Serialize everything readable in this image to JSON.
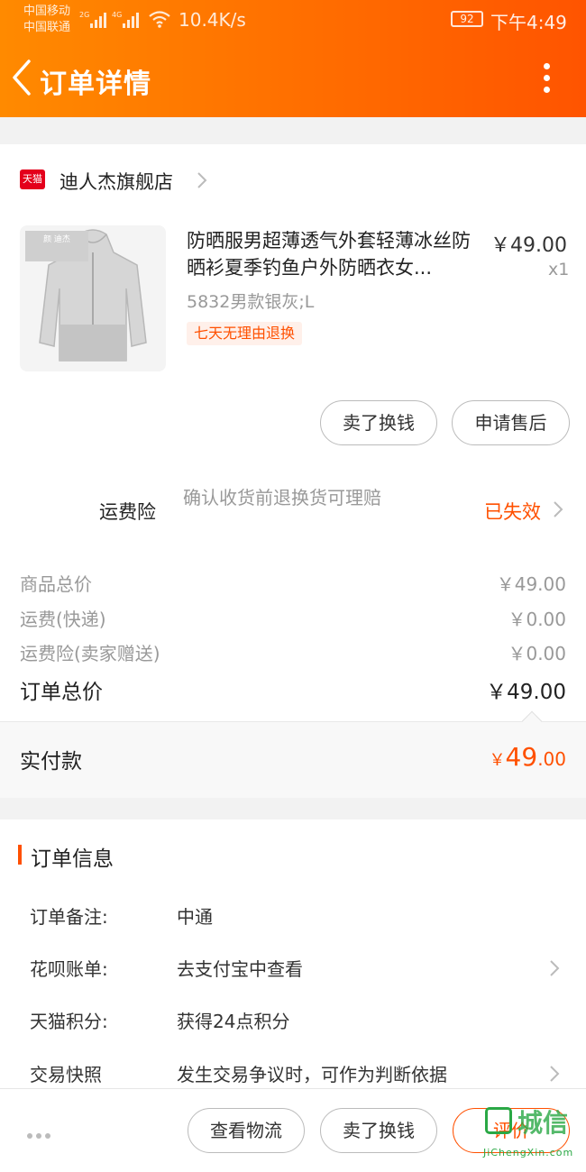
{
  "status_bar": {
    "carrier_1": "中国移动",
    "carrier_2": "中国联通",
    "net_1": "2G",
    "net_2": "4G",
    "speed": "10.4K/s",
    "battery": "92",
    "time": "下午4:49"
  },
  "nav": {
    "title": "订单详情"
  },
  "shop": {
    "logo_text": "天猫",
    "name": "迪人杰旗舰店"
  },
  "product": {
    "title": "防晒服男超薄透气外套轻薄冰丝防晒衫夏季钓鱼户外防晒衣女...",
    "price": "￥49.00",
    "qty": "x1",
    "sku": "5832男款银灰;L",
    "badge": "七天无理由退换",
    "image_tag": "颜 迪杰"
  },
  "item_buttons": {
    "sell_exchange": "卖了换钱",
    "after_sale": "申请售后"
  },
  "insurance": {
    "label": "运费险",
    "desc": "确认收货前退换货可理赔",
    "status": "已失效"
  },
  "fees": {
    "goods_label": "商品总价",
    "goods_value": "￥49.00",
    "shipping_label": "运费(快递)",
    "shipping_value": "￥0.00",
    "ins_label": "运费险(卖家赠送)",
    "ins_value": "￥0.00",
    "total_label": "订单总价",
    "total_value": "￥49.00"
  },
  "paid": {
    "label": "实付款",
    "currency": "￥",
    "integer": "49",
    "decimal": ".00"
  },
  "order_info": {
    "title": "订单信息",
    "rows": [
      {
        "key": "订单备注:",
        "value": "中通"
      },
      {
        "key": "花呗账单:",
        "value": "去支付宝中查看"
      },
      {
        "key": "天猫积分:",
        "value": "获得24点积分"
      },
      {
        "key": "交易快照",
        "value": "发生交易争议时，可作为判断依据"
      }
    ]
  },
  "bottom_bar": {
    "logistics": "查看物流",
    "sell_exchange": "卖了换钱",
    "review": "评价"
  },
  "watermark": {
    "text": "城信",
    "url": "JiChengXin.com"
  },
  "colors": {
    "accent": "#ff5000",
    "header_start": "#ff8a00",
    "header_end": "#ff5400",
    "tmall_red": "#e4001b"
  }
}
